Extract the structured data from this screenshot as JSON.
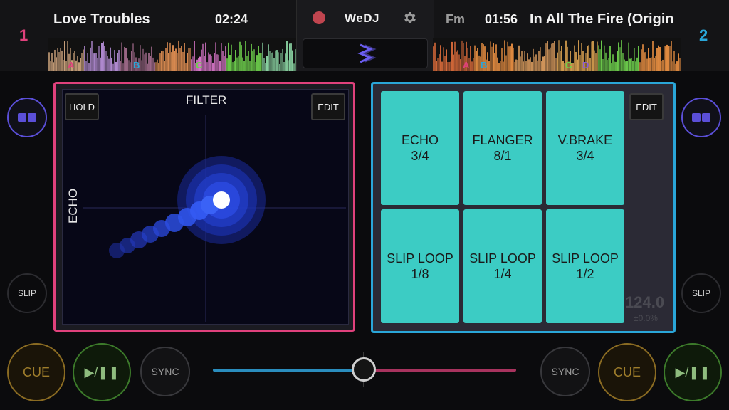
{
  "app": {
    "logo": "WeDJ"
  },
  "deck_left": {
    "number": "1",
    "title": "Love Troubles",
    "time": "02:24",
    "cues": [
      "A",
      "B",
      "C"
    ],
    "number_color": "#e0417c"
  },
  "deck_right": {
    "number": "2",
    "key": "Fm",
    "time": "01:56",
    "title": "In All The Fire (Origin",
    "cues": [
      "A",
      "B",
      "C",
      "D"
    ],
    "number_color": "#2aa6d8"
  },
  "xy_pad": {
    "hold_label": "HOLD",
    "edit_label": "EDIT",
    "x_label": "FILTER",
    "y_label": "ECHO"
  },
  "fx_pads": {
    "edit_label": "EDIT",
    "pads": [
      {
        "name": "ECHO",
        "value": "3/4"
      },
      {
        "name": "FLANGER",
        "value": "8/1"
      },
      {
        "name": "V.BRAKE",
        "value": "3/4"
      },
      {
        "name": "SLIP LOOP",
        "value": "1/8"
      },
      {
        "name": "SLIP LOOP",
        "value": "1/4"
      },
      {
        "name": "SLIP LOOP",
        "value": "1/2"
      }
    ]
  },
  "bpm": {
    "value": "124.0",
    "adjust": "±0.0%"
  },
  "controls": {
    "slip_label": "SLIP",
    "cue_label": "CUE",
    "play_label": "▶/❚❚",
    "sync_label": "SYNC"
  },
  "colors": {
    "accent_pink": "#e0417c",
    "accent_blue": "#2aa6d8",
    "pad_teal": "#3cccc4",
    "cue_gold": "#8a6b22",
    "play_green": "#3c7a2a"
  }
}
